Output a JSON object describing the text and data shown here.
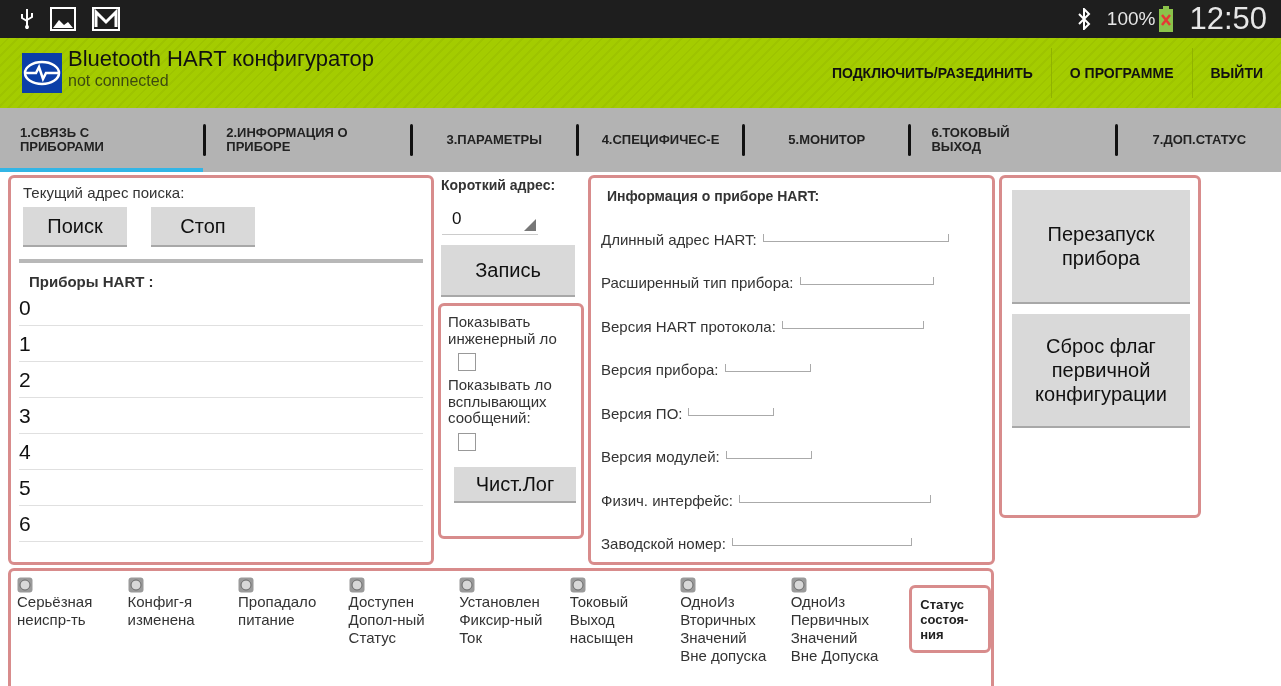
{
  "status_bar": {
    "battery": "100%",
    "time": "12:50"
  },
  "action_bar": {
    "title": "Bluetooth HART конфигуратор",
    "subtitle": "not connected",
    "actions": [
      "ПОДКЛЮЧИТЬ/РАЗЕДИНИТЬ",
      "О ПРОГРАММЕ",
      "ВЫЙТИ"
    ]
  },
  "tabs": [
    {
      "label": "1.СВЯЗЬ С ПРИБОРАМИ",
      "selected": true
    },
    {
      "label": "2.ИНФОРМАЦИЯ О ПРИБОРЕ",
      "selected": false
    },
    {
      "label": "3.ПАРАМЕТРЫ",
      "selected": false
    },
    {
      "label": "4.СПЕЦИФИЧЕС-Е",
      "selected": false
    },
    {
      "label": "5.МОНИТОР",
      "selected": false
    },
    {
      "label": "6.ТОКОВЫЙ ВЫХОД",
      "selected": false
    },
    {
      "label": "7.ДОП.СТАТУС",
      "selected": false
    }
  ],
  "search_panel": {
    "label": "Текущий адрес поиска:",
    "buttons": [
      "Поиск",
      "Стоп"
    ],
    "devices_title": "Приборы HART :",
    "devices": [
      "0",
      "1",
      "2",
      "3",
      "4",
      "5",
      "6"
    ]
  },
  "short_address": {
    "label": "Короткий адрес:",
    "value": "0",
    "button": "Запись"
  },
  "log_panel": {
    "options": [
      {
        "label": "Показывать инженерный ло",
        "checked": false
      },
      {
        "label": "Показывать ло всплывающих сообщений:",
        "checked": false
      }
    ],
    "button": "Чист.Лог"
  },
  "device_info": {
    "title": "Информация о приборе HART:",
    "fields": [
      {
        "label": "Длинный адрес HART:"
      },
      {
        "label": "Расширенный тип прибора:"
      },
      {
        "label": "Версия HART протокола:"
      },
      {
        "label": "Версия прибора:"
      },
      {
        "label": "Версия ПО:"
      },
      {
        "label": "Версия модулей:"
      },
      {
        "label": "Физич. интерфейс:"
      },
      {
        "label": "Заводской номер:"
      }
    ]
  },
  "actions_panel": {
    "buttons": [
      "Перезапуск прибора",
      "Сброс флаг первичной конфигурации"
    ]
  },
  "status_flags": [
    {
      "label": "Серьёзная неиспр-ть",
      "lit": false
    },
    {
      "label": "Конфиг-я изменена",
      "lit": false
    },
    {
      "label": "Пропадало питание",
      "lit": false
    },
    {
      "label": "Доступен Допол-ный Статус",
      "lit": false
    },
    {
      "label": "Установлен Фиксир-ный Ток",
      "lit": false
    },
    {
      "label": "Токовый Выход насыщен",
      "lit": false
    },
    {
      "label": "ОдноИз Вторичных Значений Вне допуска",
      "lit": false
    },
    {
      "label": "ОдноИз Первичных Значений Вне Допуска",
      "lit": false
    }
  ],
  "status_button": "Статус состоя-ния"
}
